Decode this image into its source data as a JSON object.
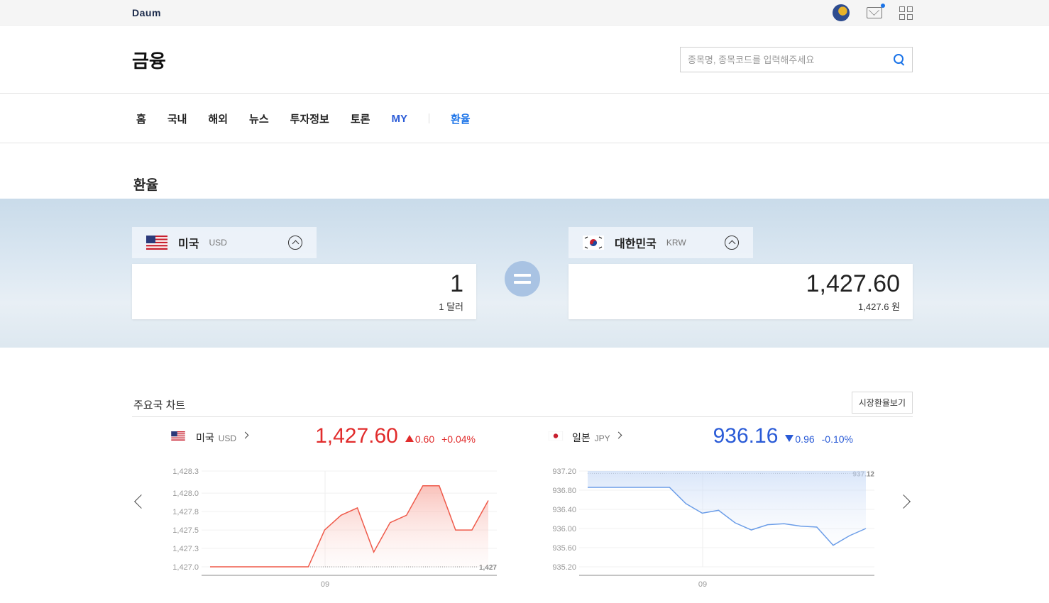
{
  "topbar": {
    "logo": "Daum"
  },
  "header": {
    "title": "금융",
    "search_placeholder": "종목명, 종목코드를 입력해주세요"
  },
  "nav": {
    "items": [
      "홈",
      "국내",
      "해외",
      "뉴스",
      "투자정보",
      "토론",
      "MY"
    ],
    "active": "환율"
  },
  "page_title": "환율",
  "converter": {
    "from": {
      "name": "미국",
      "code": "USD",
      "value": "1",
      "sub": "1 달러"
    },
    "to": {
      "name": "대한민국",
      "code": "KRW",
      "value": "1,427.60",
      "sub": "1,427.6 원"
    }
  },
  "charts_section": {
    "title": "주요국 차트",
    "market_button": "시장환율보기"
  },
  "colors": {
    "up": "#e12c2c",
    "down": "#2a5bd7",
    "accent": "#1a73e8"
  },
  "chart_data": [
    {
      "type": "area",
      "name": "미국",
      "code": "USD",
      "value": "1,427.60",
      "change": "0.60",
      "change_pct": "+0.04%",
      "direction": "up",
      "y_ticks": [
        "1,428.3",
        "1,428.0",
        "1,427.8",
        "1,427.5",
        "1,427.3",
        "1,427.0"
      ],
      "y_tick_values": [
        1428.3,
        1428.0,
        1427.75,
        1427.5,
        1427.25,
        1427.0
      ],
      "ylim": [
        1427.0,
        1428.3
      ],
      "x_tick": "09",
      "ref_label": "1,427",
      "ref_value": 1427.0,
      "values": [
        1427.0,
        1427.0,
        1427.0,
        1427.0,
        1427.0,
        1427.0,
        1427.0,
        1427.5,
        1427.7,
        1427.8,
        1427.2,
        1427.6,
        1427.7,
        1428.1,
        1428.1,
        1427.5,
        1427.5,
        1427.9
      ]
    },
    {
      "type": "area",
      "name": "일본",
      "code": "JPY",
      "value": "936.16",
      "change": "0.96",
      "change_pct": "-0.10%",
      "direction": "down",
      "y_ticks": [
        "937.20",
        "936.80",
        "936.40",
        "936.00",
        "935.60",
        "935.20"
      ],
      "y_tick_values": [
        937.2,
        936.8,
        936.4,
        936.0,
        935.6,
        935.2
      ],
      "ylim": [
        935.2,
        937.2
      ],
      "x_tick": "09",
      "ref_label": "937.12",
      "ref_value": 937.15,
      "values": [
        936.86,
        936.86,
        936.86,
        936.86,
        936.86,
        936.86,
        936.52,
        936.32,
        936.38,
        936.12,
        935.97,
        936.08,
        936.1,
        936.05,
        936.03,
        935.65,
        935.85,
        936.0
      ]
    }
  ]
}
